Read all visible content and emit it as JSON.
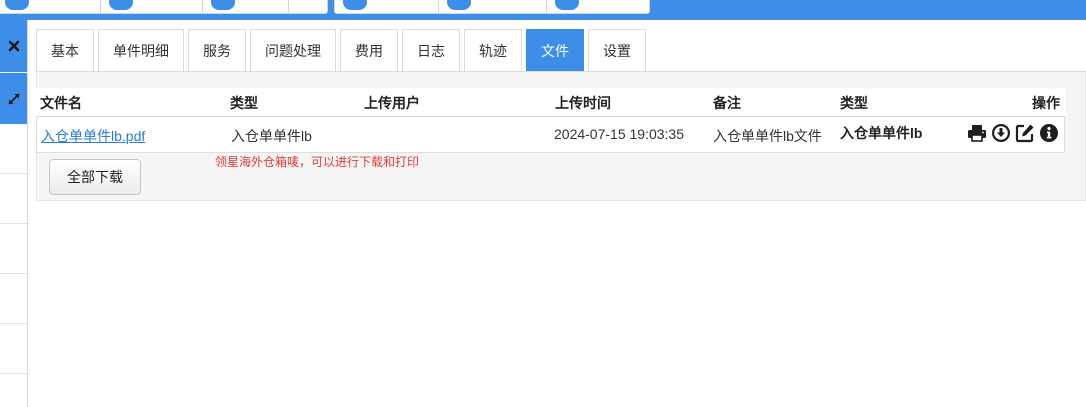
{
  "tabs": [
    {
      "label": "基本",
      "active": false
    },
    {
      "label": "单件明细",
      "active": false
    },
    {
      "label": "服务",
      "active": false
    },
    {
      "label": "问题处理",
      "active": false
    },
    {
      "label": "费用",
      "active": false
    },
    {
      "label": "日志",
      "active": false
    },
    {
      "label": "轨迹",
      "active": false
    },
    {
      "label": "文件",
      "active": true
    },
    {
      "label": "设置",
      "active": false
    }
  ],
  "sidebar": {
    "close_icon": "close-icon",
    "expand_icon": "expand-icon"
  },
  "file_table": {
    "headers": {
      "file_name": "文件名",
      "type": "类型",
      "upload_user": "上传用户",
      "upload_time": "上传时间",
      "remark": "备注",
      "type2": "类型",
      "actions": "操作"
    },
    "rows": [
      {
        "file_name": "入仓单单件lb.pdf",
        "type": "入仓单单件lb",
        "upload_user": "",
        "upload_time": "2024-07-15 19:03:35",
        "remark": "入仓单单件lb文件",
        "type2": "入仓单单件lb",
        "action_icons": [
          "print-icon",
          "download-icon",
          "edit-icon",
          "info-icon"
        ]
      }
    ]
  },
  "note": "领星海外仓箱唛，可以进行下载和打印",
  "download_all_label": "全部下载",
  "colors": {
    "accent": "#3d8ee8",
    "link": "#2d7bd2",
    "note_red": "#e03b3b"
  }
}
